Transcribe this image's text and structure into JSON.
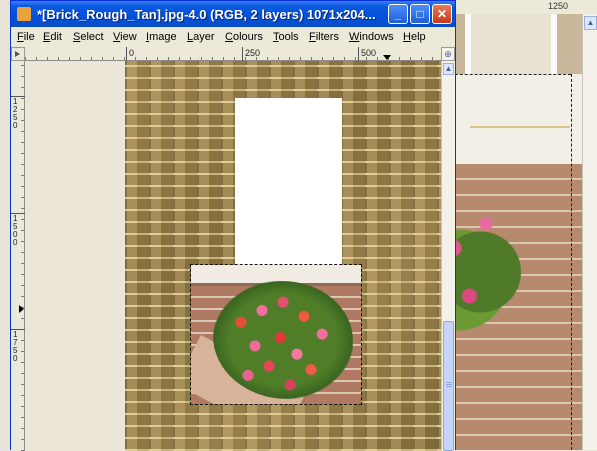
{
  "window": {
    "title": "*[Brick_Rough_Tan].jpg-4.0 (RGB, 2 layers) 1071x204...",
    "minimize": "_",
    "maximize": "□",
    "close": "✕"
  },
  "menu": {
    "file": "File",
    "edit": "Edit",
    "select": "Select",
    "view": "View",
    "image": "Image",
    "layer": "Layer",
    "colours": "Colours",
    "tools": "Tools",
    "filters": "Filters",
    "windows": "Windows",
    "help": "Help"
  },
  "ruler_top": {
    "labels": [
      "0",
      "250",
      "500"
    ]
  },
  "ruler_left": {
    "labels": [
      "1250",
      "1500",
      "1750"
    ]
  },
  "background_window": {
    "ruler_label": "1250"
  },
  "icons": {
    "app": "gimp-icon",
    "zoom": "magnifier-icon",
    "scroll_up": "arrow-up-icon",
    "ruler_corner": "quick-mask-icon"
  },
  "colors": {
    "titlebar": "#0a5ae0",
    "brick": "#8c7340",
    "canvas_pad": "#ebe6d8"
  }
}
